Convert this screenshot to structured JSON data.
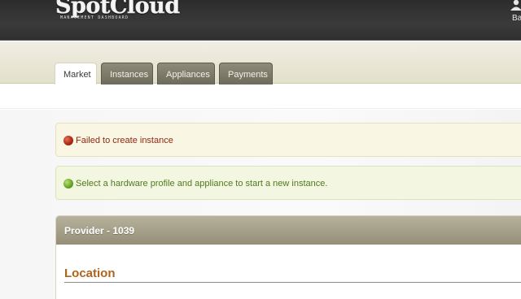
{
  "header": {
    "logo_text": "SpotCloud",
    "logo_subtitle": "MANAGEMENT DASHBOARD",
    "user_label": "Ba",
    "user_icon": "user-icon"
  },
  "tabs": [
    {
      "label": "Market",
      "active": true
    },
    {
      "label": "Instances",
      "active": false
    },
    {
      "label": "Appliances",
      "active": false
    },
    {
      "label": "Payments",
      "active": false
    }
  ],
  "messages": {
    "error": {
      "text": "Failed to create instance",
      "icon": "red-status-dot-icon",
      "color": "#8a2a13"
    },
    "success": {
      "text": "Select a hardware profile and appliance to start a new instance.",
      "icon": "green-status-dot-icon",
      "color": "#4f7a1b"
    }
  },
  "panel": {
    "title": "Provider - 1039",
    "section_title": "Location"
  },
  "colors": {
    "header_bg": "#2f2f2f",
    "tab_band_bg": "#e9e6d6",
    "panel_header_bg": "#a39e87",
    "section_title": "#b0631b"
  }
}
